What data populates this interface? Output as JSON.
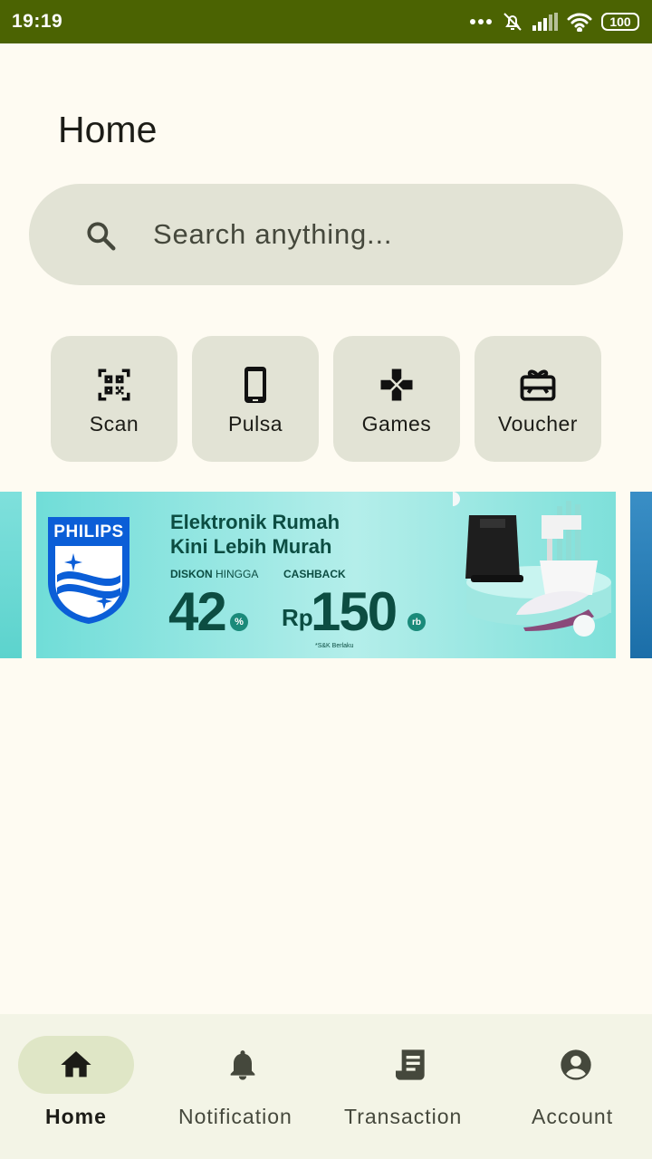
{
  "status_bar": {
    "time": "19:19",
    "battery": "100",
    "icons": [
      "more-dots-icon",
      "alarm-off-icon",
      "signal-icon",
      "wifi-icon",
      "battery-icon"
    ]
  },
  "page": {
    "title": "Home"
  },
  "search": {
    "placeholder": "Search anything..."
  },
  "quick_actions": [
    {
      "label": "Scan",
      "icon": "qr-scan-icon"
    },
    {
      "label": "Pulsa",
      "icon": "smartphone-icon"
    },
    {
      "label": "Games",
      "icon": "gamepad-icon"
    },
    {
      "label": "Voucher",
      "icon": "gift-card-icon"
    }
  ],
  "banner": {
    "brand": "PHILIPS",
    "headline_line1": "Elektronik Rumah",
    "headline_line2": "Kini Lebih Murah",
    "discount_label_bold": "DISKON",
    "discount_label_rest": " HINGGA",
    "discount_value": "42",
    "discount_unit": "%",
    "cashback_label": "CASHBACK",
    "cashback_currency": "Rp",
    "cashback_value": "150",
    "cashback_unit": "rb",
    "terms": "*S&K Berlaku"
  },
  "bottom_nav": {
    "active": "Home",
    "items": [
      {
        "label": "Home",
        "icon": "home-icon"
      },
      {
        "label": "Notification",
        "icon": "bell-icon"
      },
      {
        "label": "Transaction",
        "icon": "receipt-icon"
      },
      {
        "label": "Account",
        "icon": "account-circle-icon"
      }
    ]
  },
  "colors": {
    "status_bar": "#4b6302",
    "background": "#fefbf2",
    "surface_variant": "#e2e3d5",
    "nav_background": "#f3f4e6",
    "nav_active_pill": "#dfe6c6"
  }
}
